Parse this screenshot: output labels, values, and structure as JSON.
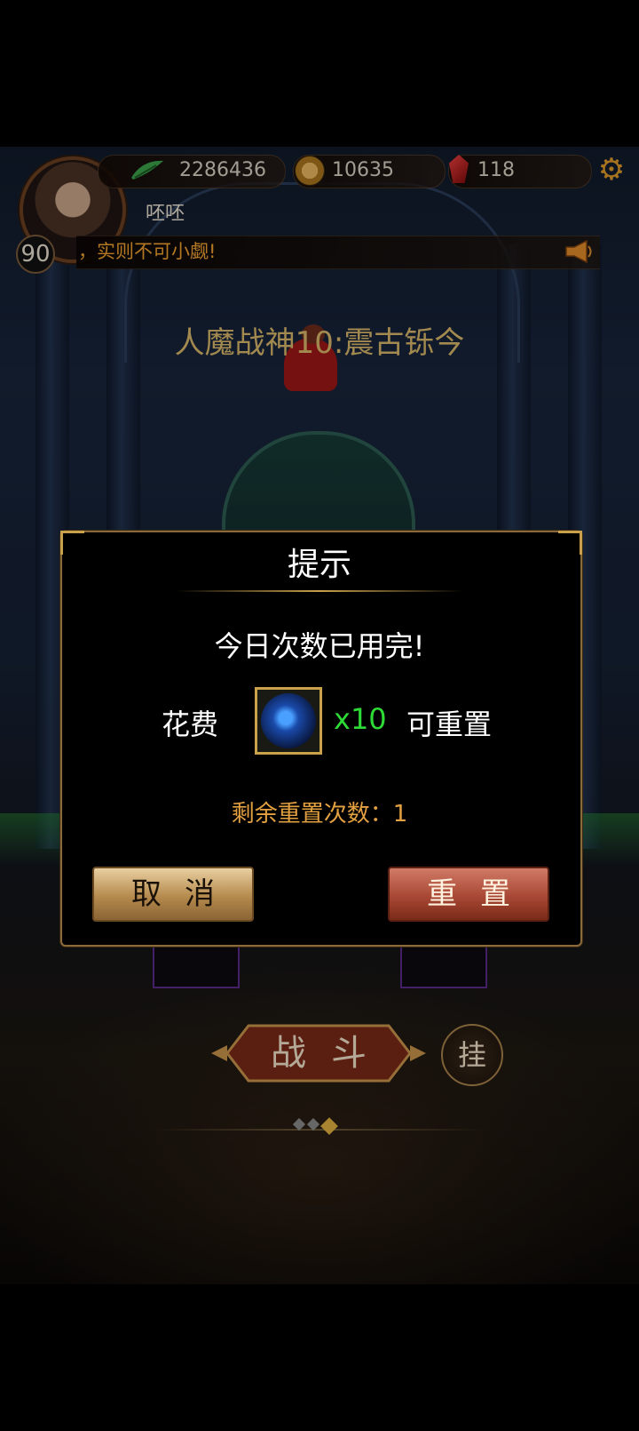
{
  "player": {
    "power": "2286436",
    "coins": "10635",
    "gems": "118",
    "name": "呸呸",
    "level": "90"
  },
  "chat": {
    "message": "，实则不可小觑!"
  },
  "stage": {
    "title": "人魔战神10:震古铄今"
  },
  "dialog": {
    "title": "提示",
    "message": "今日次数已用完!",
    "cost_label": "花费",
    "cost_quantity": "x10",
    "reset_suffix": "可重置",
    "remaining": "剩余重置次数：1",
    "cancel_label": "取消",
    "reset_label": "重置"
  },
  "actions": {
    "fight_label": "战斗",
    "auto_label": "挂"
  },
  "pagination": {
    "total": 3,
    "active": 3
  },
  "icons": {
    "power": "leaf-icon",
    "coins": "coin-icon",
    "gems": "gem-icon",
    "settings": "gear-icon",
    "chat": "horn-icon",
    "cost_item": "blue-orb-icon"
  },
  "colors": {
    "gold_text": "#d9b76a",
    "chat_text": "#f0a030",
    "quantity_green": "#2edb36",
    "remaining_text": "#e2a040"
  }
}
